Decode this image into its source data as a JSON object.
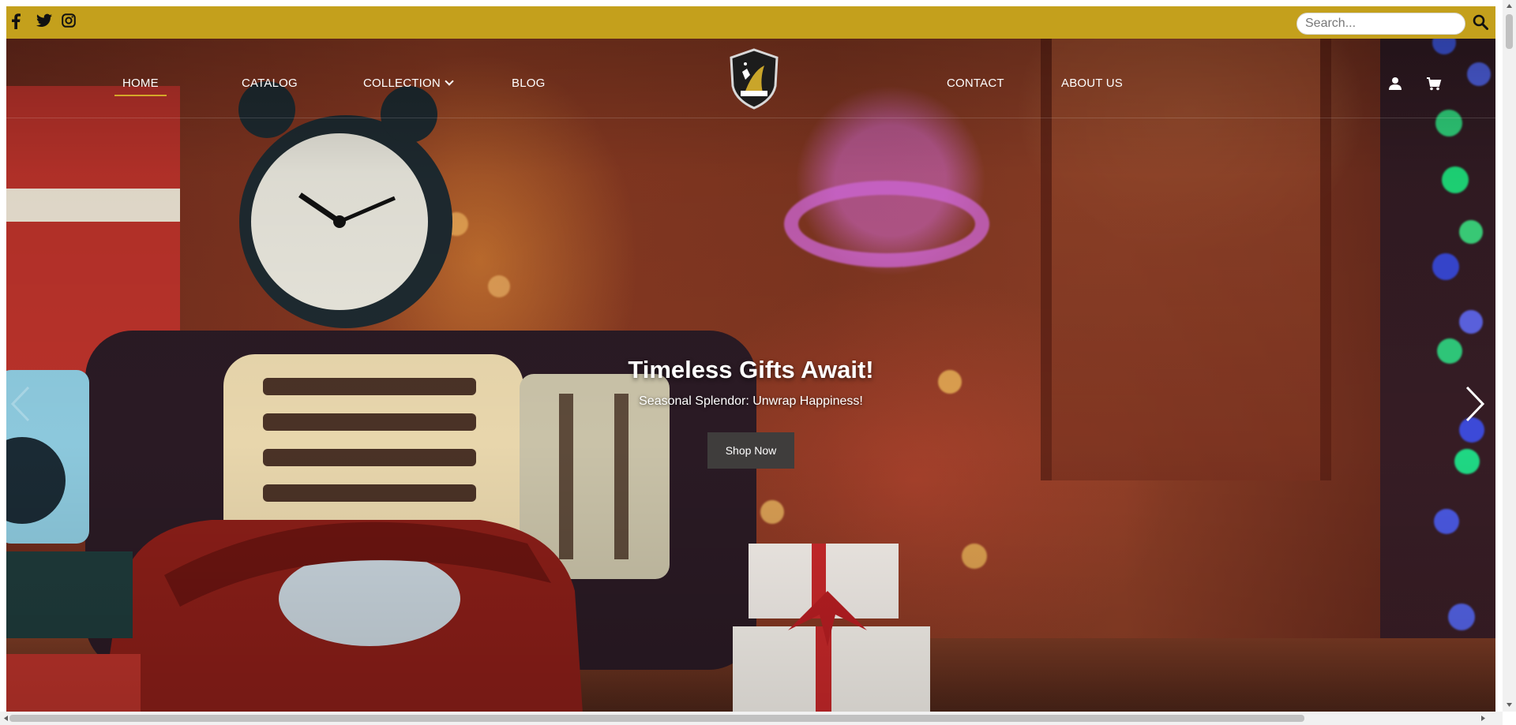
{
  "topbar": {
    "social": [
      "facebook-icon",
      "twitter-icon",
      "instagram-icon"
    ],
    "search": {
      "placeholder": "Search...",
      "value": ""
    },
    "accent_color": "#c4a01c"
  },
  "nav": {
    "items_left": [
      {
        "label": "HOME",
        "active": true
      },
      {
        "label": "CATALOG",
        "active": false
      },
      {
        "label": "COLLECTION",
        "active": false,
        "has_dropdown": true
      },
      {
        "label": "BLOG",
        "active": false
      }
    ],
    "items_right": [
      {
        "label": "CONTACT"
      },
      {
        "label": "ABOUT US"
      }
    ],
    "icons": [
      "user-icon",
      "cart-icon"
    ],
    "active_underline_color": "#d4a82a"
  },
  "hero": {
    "title": "Timeless Gifts Await!",
    "subtitle": "Seasonal Splendor: Unwrap Happiness!",
    "cta_label": "Shop Now",
    "cta_color": "#3f3d3c",
    "image_subject": "vintage clock, radio, rotary phone and gifts"
  }
}
